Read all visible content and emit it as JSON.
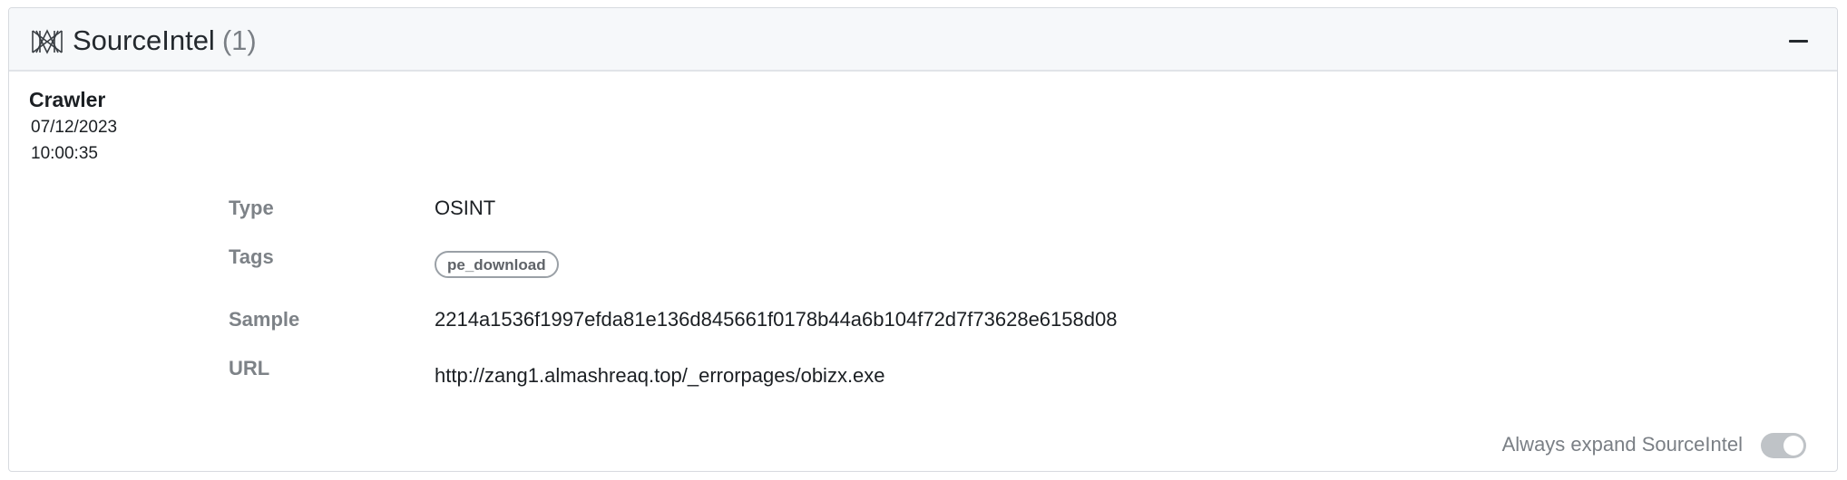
{
  "header": {
    "title": "SourceIntel",
    "count": "(1)",
    "logo_icon": "sourceintel-logo-icon",
    "collapse_icon": "minus-icon"
  },
  "source": {
    "name": "Crawler",
    "date": "07/12/2023",
    "time": "10:00:35"
  },
  "details": {
    "type_label": "Type",
    "type_value": "OSINT",
    "tags_label": "Tags",
    "tags": [
      "pe_download"
    ],
    "sample_label": "Sample",
    "sample_value": "2214a1536f1997efda81e136d845661f0178b44a6b104f72d7f73628e6158d08",
    "url_label": "URL",
    "url_value": "http://zang1.almashreaq.top/_errorpages/obizx.exe"
  },
  "footer": {
    "toggle_label": "Always expand SourceIntel",
    "toggle_on": true
  },
  "colors": {
    "header_bg": "#f6f8fa",
    "label_gray": "#7d8287",
    "toggle_bg": "#bfc3c7"
  }
}
